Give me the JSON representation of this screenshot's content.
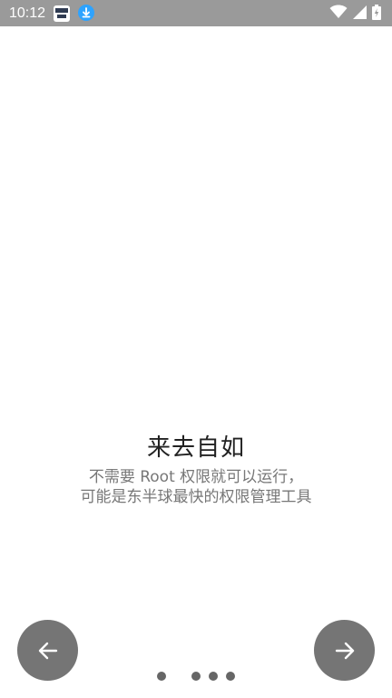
{
  "status_bar": {
    "time": "10:12",
    "notifications": [
      "app-notification-icon",
      "download-icon"
    ],
    "system_icons": [
      "wifi-icon",
      "signal-icon",
      "battery-charging-icon"
    ]
  },
  "onboarding": {
    "title": "来去自如",
    "subtitle_line1": "不需要 Root 权限就可以运行，",
    "subtitle_line2": "可能是东半球最快的权限管理工具"
  },
  "navigation": {
    "prev_icon": "arrow-left-icon",
    "next_icon": "arrow-right-icon"
  },
  "pager": {
    "page_count": 5,
    "current_page": 2
  },
  "colors": {
    "status_bar": "#9a9a9a",
    "nav_button": "#757575",
    "dot": "#666666",
    "title": "#222222",
    "subtitle": "#777777"
  }
}
